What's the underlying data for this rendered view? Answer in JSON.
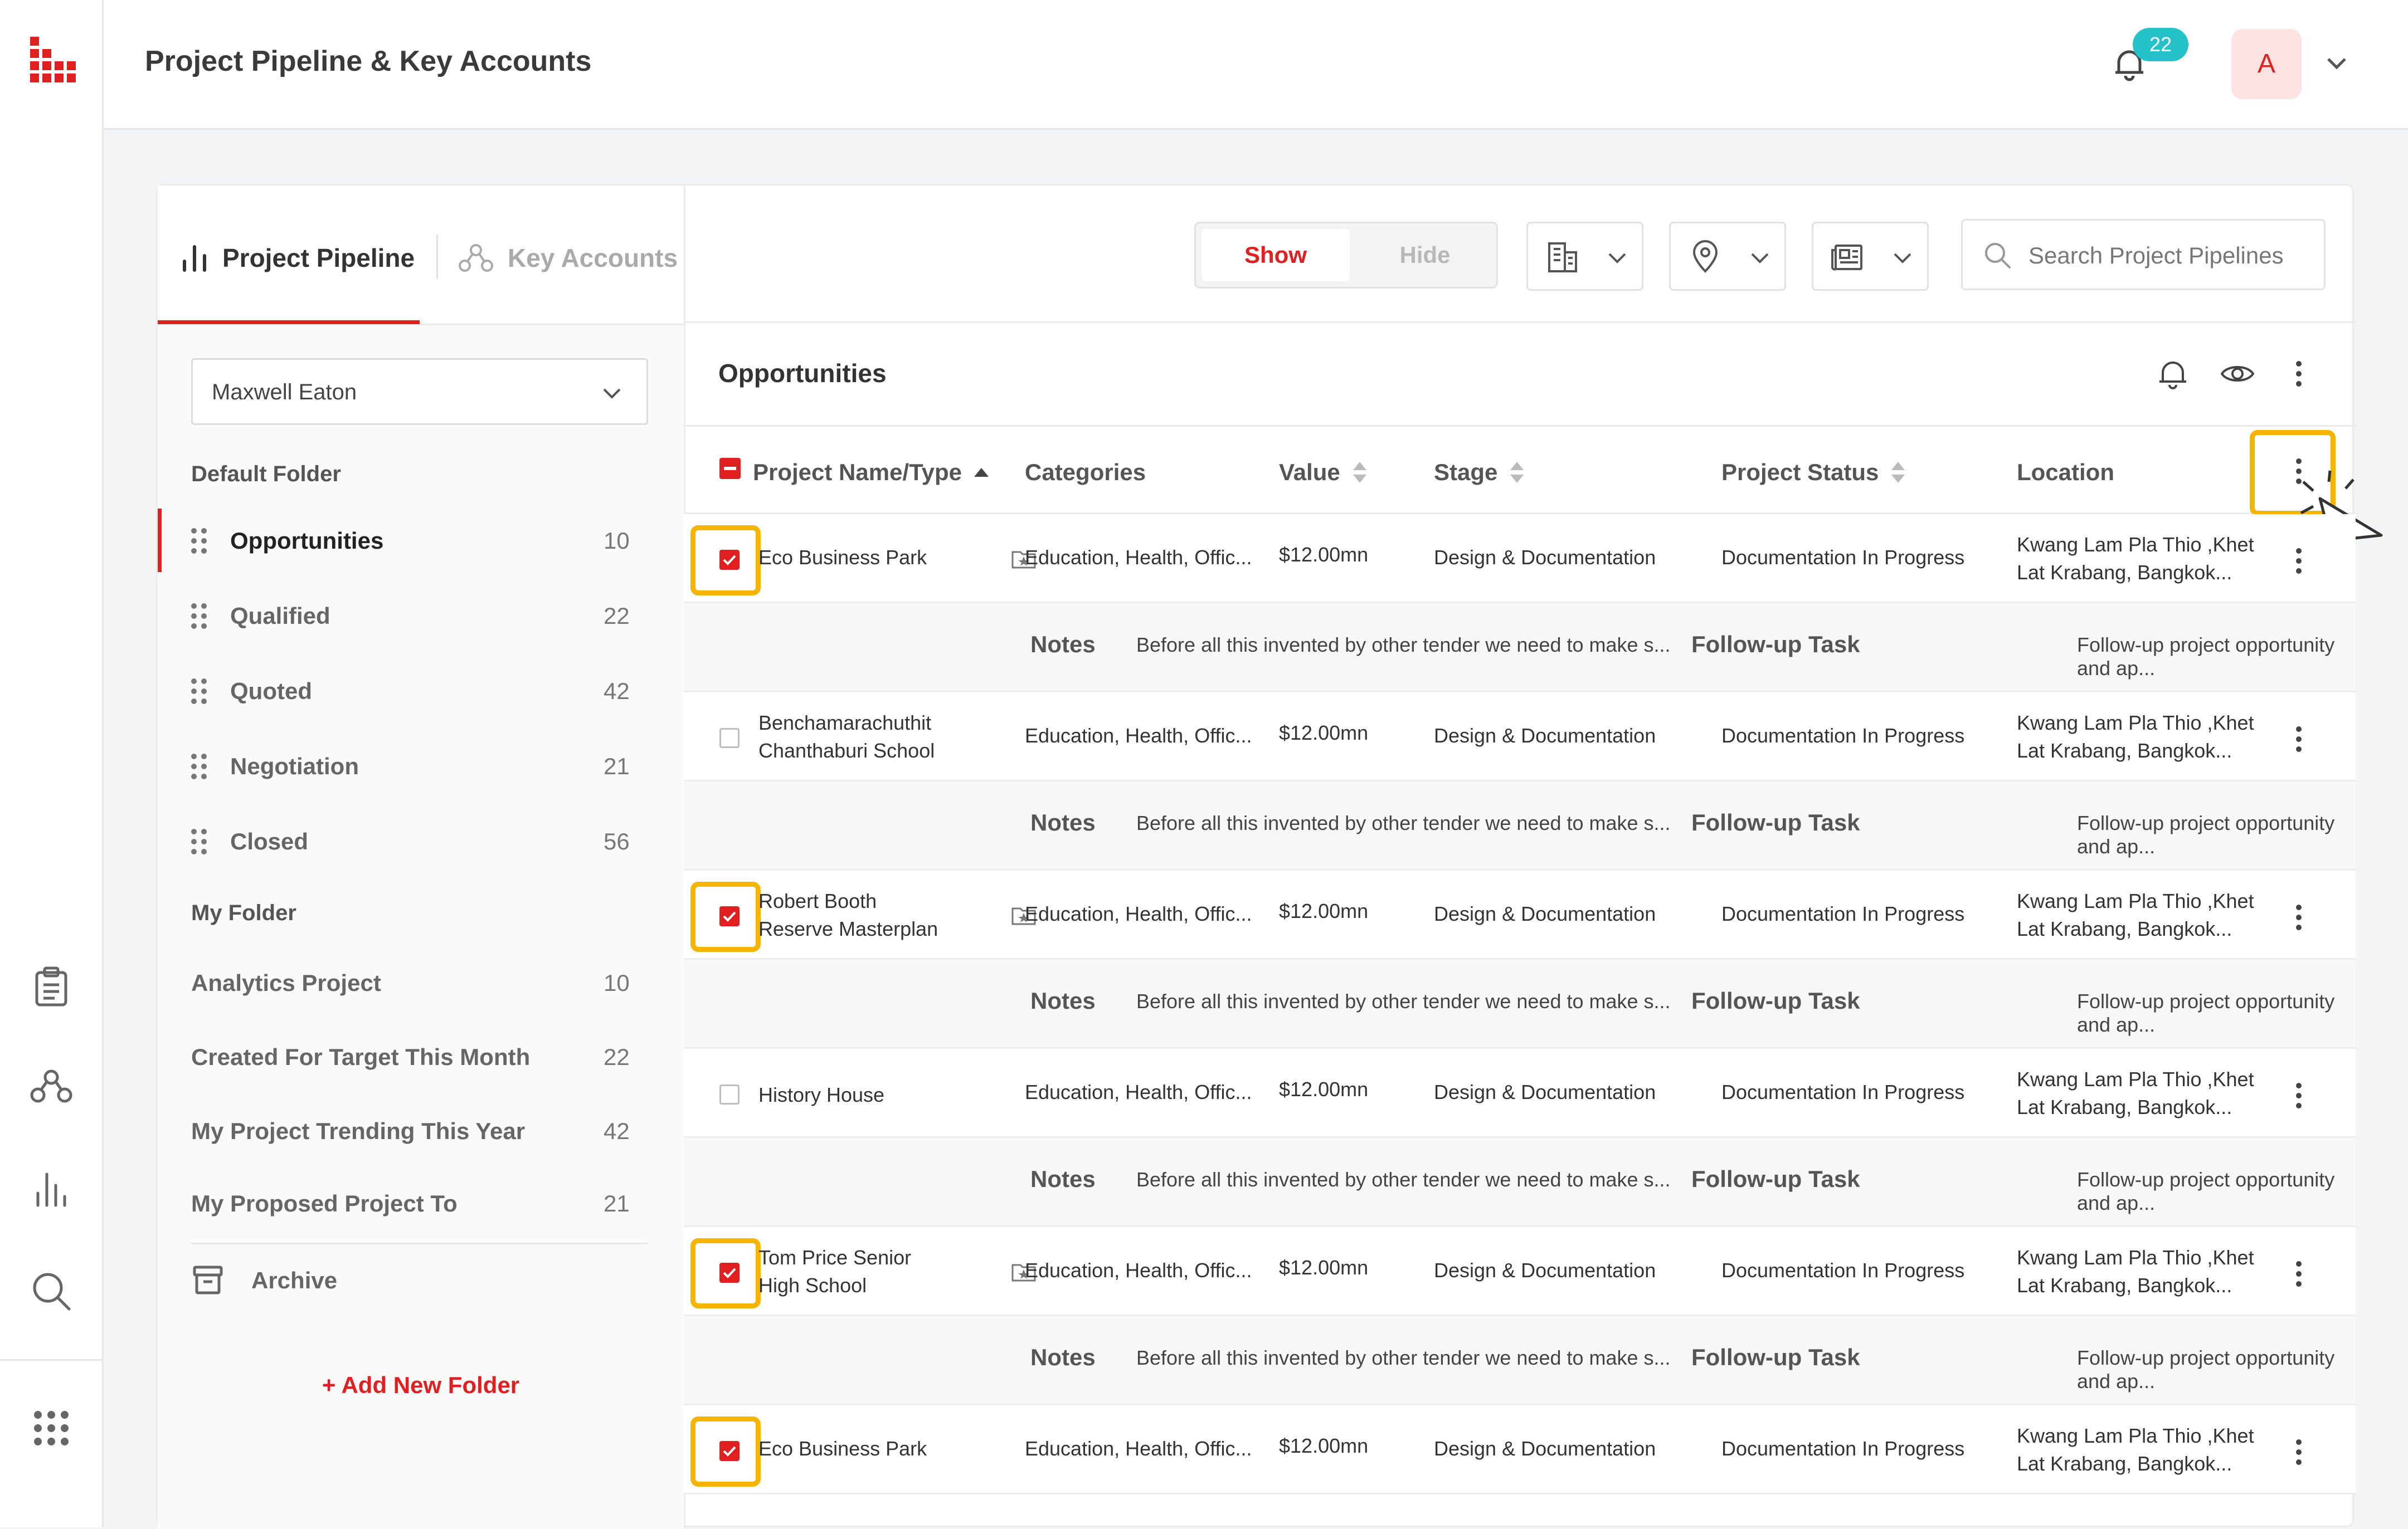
{
  "header": {
    "title": "Project Pipeline & Key Accounts",
    "notification_count": "22",
    "avatar_initial": "A"
  },
  "tabs": [
    {
      "label": "Project Pipeline",
      "active": true
    },
    {
      "label": "Key Accounts",
      "active": false
    }
  ],
  "owner": "Maxwell Eaton",
  "default_folder": {
    "title": "Default Folder",
    "items": [
      {
        "label": "Opportunities",
        "count": "10",
        "active": true
      },
      {
        "label": "Qualified",
        "count": "22"
      },
      {
        "label": "Quoted",
        "count": "42"
      },
      {
        "label": "Negotiation",
        "count": "21"
      },
      {
        "label": "Closed",
        "count": "56"
      }
    ]
  },
  "my_folder": {
    "title": "My Folder",
    "items": [
      {
        "label": "Analytics Project",
        "count": "10"
      },
      {
        "label": "Created For Target This Month",
        "count": "22"
      },
      {
        "label": "My Project Trending This Year",
        "count": "42"
      },
      {
        "label": "My Proposed Project To",
        "count": "21"
      }
    ]
  },
  "archive_label": "Archive",
  "add_folder_label": "+ Add New Folder",
  "toolbar": {
    "show_label": "Show",
    "hide_label": "Hide",
    "search_placeholder": "Search Project Pipelines"
  },
  "panel_title": "Opportunities",
  "columns": [
    "Project Name/Type",
    "Categories",
    "Value",
    "Stage",
    "Project Status",
    "Location"
  ],
  "notes_label": "Notes",
  "followup_label": "Follow-up Task",
  "rows": [
    {
      "name": [
        "Eco Business Park"
      ],
      "checked": true,
      "fav": true,
      "categories": "Education, Health, Offic...",
      "value": "$12.00mn",
      "stage": "Design & Documentation",
      "status": "Documentation In Progress",
      "location": [
        "Kwang Lam Pla Thio ,Khet",
        "Lat Krabang, Bangkok..."
      ],
      "note": "Before all this invented by other tender we need to make s...",
      "followup": "Follow-up project opportunity and ap..."
    },
    {
      "name": [
        "Benchamarachuthit",
        "Chanthaburi School"
      ],
      "checked": false,
      "fav": false,
      "categories": "Education, Health, Offic...",
      "value": "$12.00mn",
      "stage": "Design & Documentation",
      "status": "Documentation In Progress",
      "location": [
        "Kwang Lam Pla Thio ,Khet",
        "Lat Krabang, Bangkok..."
      ],
      "note": "Before all this invented by other tender we need to make s...",
      "followup": "Follow-up project opportunity and ap..."
    },
    {
      "name": [
        "Robert Booth",
        "Reserve Masterplan"
      ],
      "checked": true,
      "fav": true,
      "categories": "Education, Health, Offic...",
      "value": "$12.00mn",
      "stage": "Design & Documentation",
      "status": "Documentation In Progress",
      "location": [
        "Kwang Lam Pla Thio ,Khet",
        "Lat Krabang, Bangkok..."
      ],
      "note": "Before all this invented by other tender we need to make s...",
      "followup": "Follow-up project opportunity and ap..."
    },
    {
      "name": [
        "History House"
      ],
      "checked": false,
      "fav": false,
      "categories": "Education, Health, Offic...",
      "value": "$12.00mn",
      "stage": "Design & Documentation",
      "status": "Documentation In Progress",
      "location": [
        "Kwang Lam Pla Thio ,Khet",
        "Lat Krabang, Bangkok..."
      ],
      "note": "Before all this invented by other tender we need to make s...",
      "followup": "Follow-up project opportunity and ap..."
    },
    {
      "name": [
        "Tom Price Senior",
        "High School"
      ],
      "checked": true,
      "fav": true,
      "categories": "Education, Health, Offic...",
      "value": "$12.00mn",
      "stage": "Design & Documentation",
      "status": "Documentation In Progress",
      "location": [
        "Kwang Lam Pla Thio ,Khet",
        "Lat Krabang, Bangkok..."
      ],
      "note": "Before all this invented by other tender we need to make s...",
      "followup": "Follow-up project opportunity and ap..."
    },
    {
      "name": [
        "Eco Business Park"
      ],
      "checked": true,
      "fav": false,
      "categories": "Education, Health, Offic...",
      "value": "$12.00mn",
      "stage": "Design & Documentation",
      "status": "Documentation In Progress",
      "location": [
        "Kwang Lam Pla Thio ,Khet",
        "Lat Krabang, Bangkok..."
      ],
      "note": "",
      "followup": ""
    }
  ],
  "icons": {
    "logo": "app-logo-icon",
    "rail": [
      "clipboard-icon",
      "network-icon",
      "chart-bars-icon",
      "search-icon",
      "grid-dots-icon"
    ],
    "toolbar": [
      "building-icon",
      "location-pin-icon",
      "newspaper-icon",
      "search-icon"
    ],
    "panel": [
      "bell-icon",
      "eye-icon",
      "more-vertical-icon"
    ]
  },
  "colors": {
    "accent": "#e02020",
    "highlight": "#f5b400",
    "badge": "#26c2c9"
  }
}
